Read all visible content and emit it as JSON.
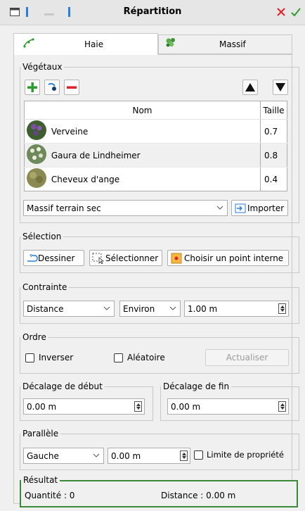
{
  "window": {
    "title": "Répartition"
  },
  "tabs": [
    {
      "label": "Haie",
      "icon": "hedge-icon",
      "active": true
    },
    {
      "label": "Massif",
      "icon": "bed-icon",
      "active": false
    }
  ],
  "vegetaux": {
    "legend": "Végétaux",
    "columns": {
      "name": "Nom",
      "size": "Taille"
    },
    "rows": [
      {
        "name": "Verveine",
        "size": "0.7"
      },
      {
        "name": "Gaura de Lindheimer",
        "size": "0.8"
      },
      {
        "name": "Cheveux d'ange",
        "size": "0.4"
      }
    ],
    "preset": "Massif terrain sec",
    "import_label": "Importer"
  },
  "selection": {
    "legend": "Sélection",
    "draw_label": "Dessiner",
    "select_label": "Sélectionner",
    "inner_point_label": "Choisir un point interne"
  },
  "contrainte": {
    "legend": "Contrainte",
    "mode": "Distance",
    "approx": "Environ",
    "value": "1.00 m"
  },
  "ordre": {
    "legend": "Ordre",
    "invert_label": "Inverser",
    "random_label": "Aléatoire",
    "refresh_label": "Actualiser"
  },
  "decalage_debut": {
    "legend": "Décalage de début",
    "value": "0.00 m"
  },
  "decalage_fin": {
    "legend": "Décalage de fin",
    "value": "0.00 m"
  },
  "parallele": {
    "legend": "Parallèle",
    "side": "Gauche",
    "value": "0.00 m",
    "limit_label": "Limite de propriété"
  },
  "resultat": {
    "legend": "Résultat",
    "quantity_label": "Quantité : 0",
    "distance_label": "Distance : 0.00 m"
  },
  "colors": {
    "add": "#2e9d2e",
    "remove": "#e0202a",
    "accent_blue": "#2a7de1",
    "result_border": "#3a8a3a"
  }
}
